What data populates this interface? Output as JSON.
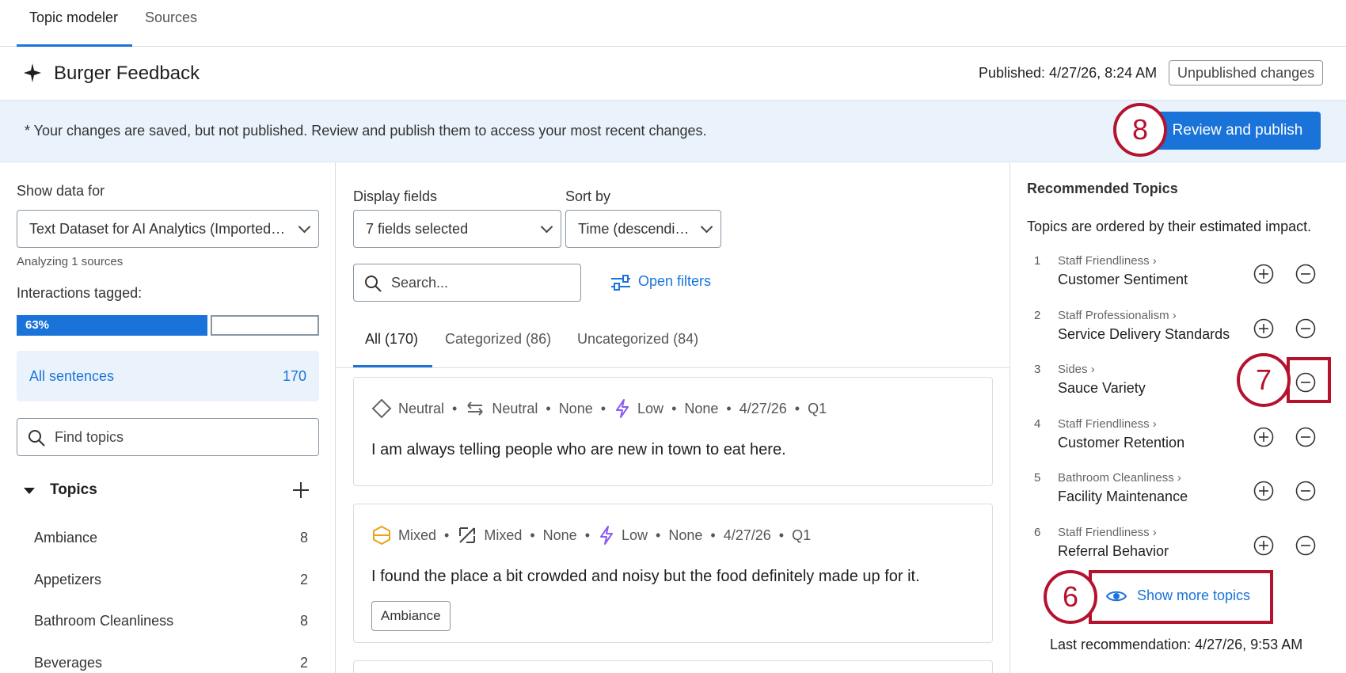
{
  "tabs": {
    "topic_modeler": "Topic modeler",
    "sources": "Sources"
  },
  "header": {
    "title": "Burger Feedback",
    "published": "Published: 4/27/26, 8:24 AM",
    "unpublished_badge": "Unpublished changes"
  },
  "banner": {
    "text": "* Your changes are saved, but not published. Review and publish them to access your most recent changes.",
    "publish_button": "Review and publish"
  },
  "callouts": {
    "six": "6",
    "seven": "7",
    "eight": "8"
  },
  "left": {
    "show_data_for": "Show data for",
    "dataset": "Text Dataset for AI Analytics (Imported…",
    "analyzing": "Analyzing 1 sources",
    "interactions_tagged": "Interactions tagged:",
    "progress_percent": 63,
    "progress_label": "63%",
    "all_sentences": {
      "label": "All sentences",
      "count": "170"
    },
    "find_topics_placeholder": "Find topics",
    "topics_title": "Topics",
    "topics": [
      {
        "name": "Ambiance",
        "count": "8"
      },
      {
        "name": "Appetizers",
        "count": "2"
      },
      {
        "name": "Bathroom Cleanliness",
        "count": "8"
      },
      {
        "name": "Beverages",
        "count": "2"
      }
    ]
  },
  "middle": {
    "display_fields_label": "Display fields",
    "display_fields_value": "7 fields selected",
    "sort_by_label": "Sort by",
    "sort_by_value": "Time (descendi…",
    "search_placeholder": "Search...",
    "open_filters": "Open filters",
    "tabs": [
      {
        "label": "All (170)"
      },
      {
        "label": "Categorized (86)"
      },
      {
        "label": "Uncategorized (84)"
      }
    ],
    "cards": [
      {
        "sentiment": "Neutral",
        "emotion": "Neutral",
        "f3": "None",
        "effort": "Low",
        "f5": "None",
        "date": "4/27/26",
        "quarter": "Q1",
        "text": "I am always telling people who are new in town to eat here."
      },
      {
        "sentiment": "Mixed",
        "emotion": "Mixed",
        "f3": "None",
        "effort": "Low",
        "f5": "None",
        "date": "4/27/26",
        "quarter": "Q1",
        "text": "I found the place a bit crowded and noisy but the food definitely made up for it.",
        "tag": "Ambiance"
      }
    ]
  },
  "right": {
    "title": "Recommended Topics",
    "subtitle": "Topics are ordered by their estimated impact.",
    "items": [
      {
        "num": "1",
        "parent": "Staff Friendliness ›",
        "name": "Customer Sentiment"
      },
      {
        "num": "2",
        "parent": "Staff Professionalism ›",
        "name": "Service Delivery Standards"
      },
      {
        "num": "3",
        "parent": "Sides ›",
        "name": "Sauce Variety"
      },
      {
        "num": "4",
        "parent": "Staff Friendliness ›",
        "name": "Customer Retention"
      },
      {
        "num": "5",
        "parent": "Bathroom Cleanliness ›",
        "name": "Facility Maintenance"
      },
      {
        "num": "6",
        "parent": "Staff Friendliness ›",
        "name": "Referral Behavior"
      }
    ],
    "show_more": "Show more topics",
    "last_recommendation": "Last recommendation: 4/27/26, 9:53 AM"
  },
  "colors": {
    "accent": "#1a73d9",
    "callout": "#b5122e",
    "banner_bg": "#eaf3fc",
    "mixed": "#e8a317",
    "effort": "#8b5cf6"
  }
}
